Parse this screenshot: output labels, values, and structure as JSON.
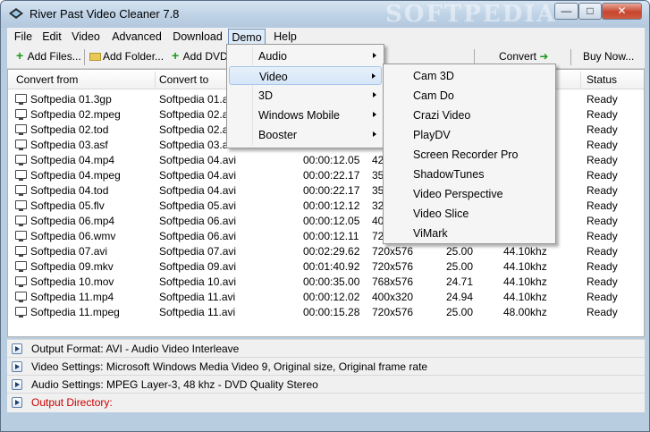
{
  "window": {
    "title": "River Past Video Cleaner 7.8",
    "watermark": "SOFTPEDIA"
  },
  "menubar": [
    "File",
    "Edit",
    "Video",
    "Advanced",
    "Download",
    "Demo",
    "Help"
  ],
  "toolbar": {
    "add_files": "Add Files...",
    "add_folder": "Add Folder...",
    "add_dvd": "Add DVD",
    "convert": "Convert",
    "buy_now": "Buy Now..."
  },
  "columns": [
    "Convert from",
    "Convert to",
    "Status"
  ],
  "rows": [
    {
      "from": "Softpedia 01.3gp",
      "to": "Softpedia 01.avi",
      "duration": "",
      "size": "",
      "fps": "",
      "audio": "",
      "status": "Ready"
    },
    {
      "from": "Softpedia 02.mpeg",
      "to": "Softpedia 02.avi",
      "duration": "",
      "size": "",
      "fps": "",
      "audio": "",
      "status": "Ready"
    },
    {
      "from": "Softpedia 02.tod",
      "to": "Softpedia 02.avi",
      "duration": "",
      "size": "",
      "fps": "",
      "audio": "",
      "status": "Ready"
    },
    {
      "from": "Softpedia 03.asf",
      "to": "Softpedia 03.avi",
      "duration": "",
      "size": "",
      "fps": "",
      "audio": "",
      "status": "Ready"
    },
    {
      "from": "Softpedia 04.mp4",
      "to": "Softpedia 04.avi",
      "duration": "00:00:12.05",
      "size": "42",
      "fps": "",
      "audio": "",
      "status": "Ready"
    },
    {
      "from": "Softpedia 04.mpeg",
      "to": "Softpedia 04.avi",
      "duration": "00:00:22.17",
      "size": "35",
      "fps": "",
      "audio": "",
      "status": "Ready"
    },
    {
      "from": "Softpedia 04.tod",
      "to": "Softpedia 04.avi",
      "duration": "00:00:22.17",
      "size": "35",
      "fps": "",
      "audio": "",
      "status": "Ready"
    },
    {
      "from": "Softpedia 05.flv",
      "to": "Softpedia 05.avi",
      "duration": "00:00:12.12",
      "size": "32",
      "fps": "",
      "audio": "",
      "status": "Ready"
    },
    {
      "from": "Softpedia 06.mp4",
      "to": "Softpedia 06.avi",
      "duration": "00:00:12.05",
      "size": "40",
      "fps": "",
      "audio": "",
      "status": "Ready"
    },
    {
      "from": "Softpedia 06.wmv",
      "to": "Softpedia 06.avi",
      "duration": "00:00:12.11",
      "size": "72",
      "fps": "",
      "audio": "",
      "status": "Ready"
    },
    {
      "from": "Softpedia 07.avi",
      "to": "Softpedia 07.avi",
      "duration": "00:02:29.62",
      "size": "720x576",
      "fps": "25.00",
      "audio": "44.10khz",
      "status": "Ready"
    },
    {
      "from": "Softpedia 09.mkv",
      "to": "Softpedia 09.avi",
      "duration": "00:01:40.92",
      "size": "720x576",
      "fps": "25.00",
      "audio": "44.10khz",
      "status": "Ready"
    },
    {
      "from": "Softpedia 10.mov",
      "to": "Softpedia 10.avi",
      "duration": "00:00:35.00",
      "size": "768x576",
      "fps": "24.71",
      "audio": "44.10khz",
      "status": "Ready"
    },
    {
      "from": "Softpedia 11.mp4",
      "to": "Softpedia 11.avi",
      "duration": "00:00:12.02",
      "size": "400x320",
      "fps": "24.94",
      "audio": "44.10khz",
      "status": "Ready"
    },
    {
      "from": "Softpedia 11.mpeg",
      "to": "Softpedia 11.avi",
      "duration": "00:00:15.28",
      "size": "720x576",
      "fps": "25.00",
      "audio": "48.00khz",
      "status": "Ready"
    }
  ],
  "panels": [
    {
      "text": "Output Format: AVI - Audio Video Interleave",
      "color": "#000000"
    },
    {
      "text": "Video Settings: Microsoft Windows Media Video 9, Original size, Original frame rate",
      "color": "#000000"
    },
    {
      "text": "Audio Settings: MPEG Layer-3, 48 khz - DVD Quality Stereo",
      "color": "#000000"
    },
    {
      "text": "Output Directory:",
      "color": "#cc0000"
    }
  ],
  "demo_menu": [
    "Audio",
    "Video",
    "3D",
    "Windows Mobile",
    "Booster"
  ],
  "video_submenu": [
    "Cam 3D",
    "Cam Do",
    "Crazi Video",
    "PlayDV",
    "Screen Recorder Pro",
    "ShadowTunes",
    "Video Perspective",
    "Video Slice",
    "ViMark"
  ],
  "icons": {
    "close": "close-icon",
    "maximize": "maximize-icon",
    "minimize": "minimize-icon",
    "convert": "arrow-right-icon"
  }
}
